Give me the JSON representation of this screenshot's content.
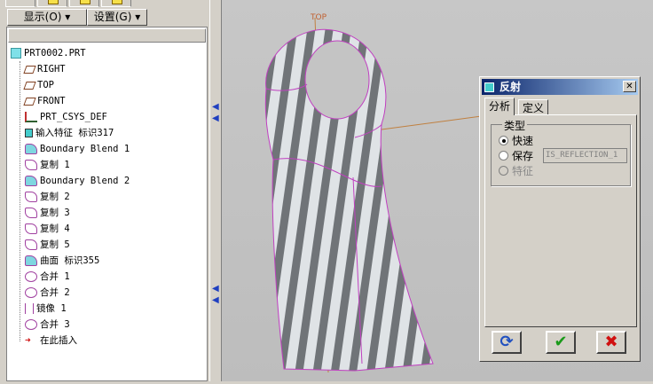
{
  "toolbar": {
    "show_label": "显示(O) ▾",
    "settings_label": "设置(G) ▾"
  },
  "tree": {
    "root": "PRT0002.PRT",
    "items": [
      {
        "label": "RIGHT",
        "icon": "datum-plane-icon"
      },
      {
        "label": "TOP",
        "icon": "datum-plane-icon"
      },
      {
        "label": "FRONT",
        "icon": "datum-plane-icon"
      },
      {
        "label": "PRT_CSYS_DEF",
        "icon": "csys-icon"
      },
      {
        "label": "输入特征 标识317",
        "icon": "import-feature-icon"
      },
      {
        "label": "Boundary Blend 1",
        "icon": "boundary-blend-icon"
      },
      {
        "label": "复制 1",
        "icon": "copy-icon"
      },
      {
        "label": "Boundary Blend 2",
        "icon": "boundary-blend-icon"
      },
      {
        "label": "复制 2",
        "icon": "copy-icon"
      },
      {
        "label": "复制 3",
        "icon": "copy-icon"
      },
      {
        "label": "复制 4",
        "icon": "copy-icon"
      },
      {
        "label": "复制 5",
        "icon": "copy-icon"
      },
      {
        "label": "曲面 标识355",
        "icon": "surface-icon"
      },
      {
        "label": "合并 1",
        "icon": "merge-icon"
      },
      {
        "label": "合并 2",
        "icon": "merge-icon"
      },
      {
        "label": "镜像 1",
        "icon": "mirror-icon"
      },
      {
        "label": "合并 3",
        "icon": "merge-icon"
      },
      {
        "label": "在此插入",
        "icon": "insert-here-arrow-icon"
      }
    ]
  },
  "viewport": {
    "datum_label": "TOP"
  },
  "dialog": {
    "title": "反射",
    "tabs": [
      "分析",
      "定义"
    ],
    "group_label": "类型",
    "options": [
      {
        "label": "快速",
        "selected": true,
        "enabled": true
      },
      {
        "label": "保存",
        "selected": false,
        "enabled": true
      },
      {
        "label": "特征",
        "selected": false,
        "enabled": false
      }
    ],
    "name_value": "IS_REFLECTION_1",
    "buttons": {
      "repeat": "⟳",
      "ok": "✔",
      "cancel": "✖"
    }
  },
  "colors": {
    "ok": "#1a9a1a",
    "cancel": "#d01010",
    "accent": "#0a246a"
  }
}
